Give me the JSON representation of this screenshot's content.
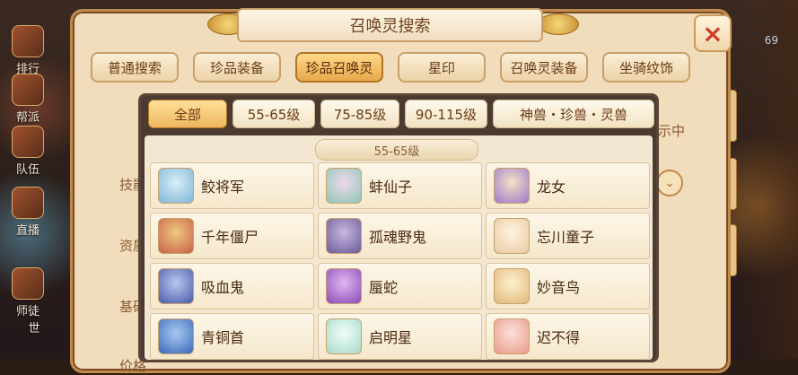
{
  "left_menu": [
    {
      "label": "排行",
      "icon": "trophy-icon"
    },
    {
      "label": "帮派",
      "icon": "guild-icon"
    },
    {
      "label": "队伍",
      "icon": "team-icon"
    },
    {
      "label": "直播",
      "icon": "live-icon"
    },
    {
      "label": "师徒",
      "icon": "mentor-icon"
    },
    {
      "label": "世",
      "icon": "voice-icon"
    }
  ],
  "right_counter": "69",
  "dialog": {
    "title": "召唤灵搜索",
    "close_icon": "×",
    "top_tabs": [
      {
        "label": "普通搜索",
        "active": false
      },
      {
        "label": "珍品装备",
        "active": false
      },
      {
        "label": "珍品召唤灵",
        "active": true
      },
      {
        "label": "星印",
        "active": false
      },
      {
        "label": "召唤灵装备",
        "active": false
      },
      {
        "label": "坐骑纹饰",
        "active": false
      }
    ],
    "bg_labels": [
      "技能",
      "资质",
      "基础",
      "价格"
    ],
    "bg_right_label": "示中",
    "bg_chevron_icon": "chevron-down-icon"
  },
  "panel": {
    "filter_tabs": [
      {
        "label": "全部",
        "active": true
      },
      {
        "label": "55-65级",
        "active": false
      },
      {
        "label": "75-85级",
        "active": false
      },
      {
        "label": "90-115级",
        "active": false
      },
      {
        "label": "神兽・珍兽・灵兽",
        "active": false
      }
    ],
    "group_header": "55-65级",
    "items": [
      {
        "name": "鲛将军",
        "avatar": "blue-ghost-general-avatar",
        "color": "#7fb6d8"
      },
      {
        "name": "蚌仙子",
        "avatar": "clam-fairy-avatar",
        "color": "#8cc7b8"
      },
      {
        "name": "龙女",
        "avatar": "dragon-girl-avatar",
        "color": "#9c7ac8"
      },
      {
        "name": "千年僵尸",
        "avatar": "zombie-avatar",
        "color": "#c8604a"
      },
      {
        "name": "孤魂野鬼",
        "avatar": "wild-ghost-avatar",
        "color": "#6a5a9a"
      },
      {
        "name": "忘川童子",
        "avatar": "river-child-avatar",
        "color": "#e8c8a0"
      },
      {
        "name": "吸血鬼",
        "avatar": "vampire-avatar",
        "color": "#4a5aa8"
      },
      {
        "name": "蜃蛇",
        "avatar": "mirage-snake-avatar",
        "color": "#8a4ab8"
      },
      {
        "name": "妙音鸟",
        "avatar": "music-bird-avatar",
        "color": "#e0b878"
      },
      {
        "name": "青铜首",
        "avatar": "bronze-head-avatar",
        "color": "#3a6ab8"
      },
      {
        "name": "启明星",
        "avatar": "morning-star-avatar",
        "color": "#a8d8c8"
      },
      {
        "name": "迟不得",
        "avatar": "pig-avatar",
        "color": "#e89a8a"
      }
    ]
  }
}
